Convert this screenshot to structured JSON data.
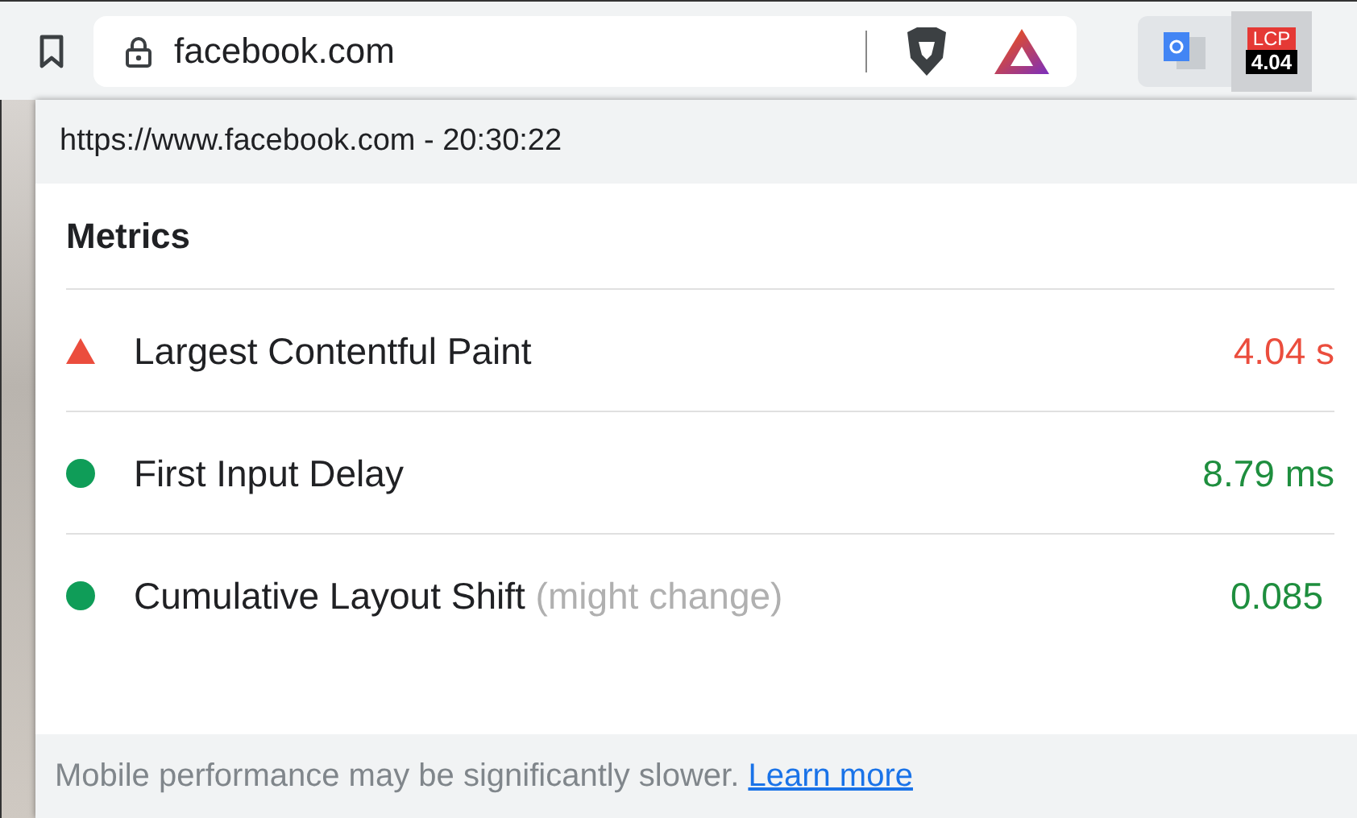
{
  "address_bar": {
    "domain": "facebook.com"
  },
  "extension_badge": {
    "label": "LCP",
    "value": "4.04"
  },
  "popup": {
    "header": "https://www.facebook.com - 20:30:22",
    "section_title": "Metrics",
    "metrics": [
      {
        "name": "Largest Contentful Paint",
        "kind": "poor",
        "value": "4.04 s"
      },
      {
        "name": "First Input Delay",
        "kind": "good",
        "value": "8.79 ms"
      },
      {
        "name": "Cumulative Layout Shift",
        "note": "(might change)",
        "kind": "good",
        "value": "0.085"
      }
    ],
    "footer": {
      "text": "Mobile performance may be significantly slower.",
      "link": "Learn more"
    }
  }
}
